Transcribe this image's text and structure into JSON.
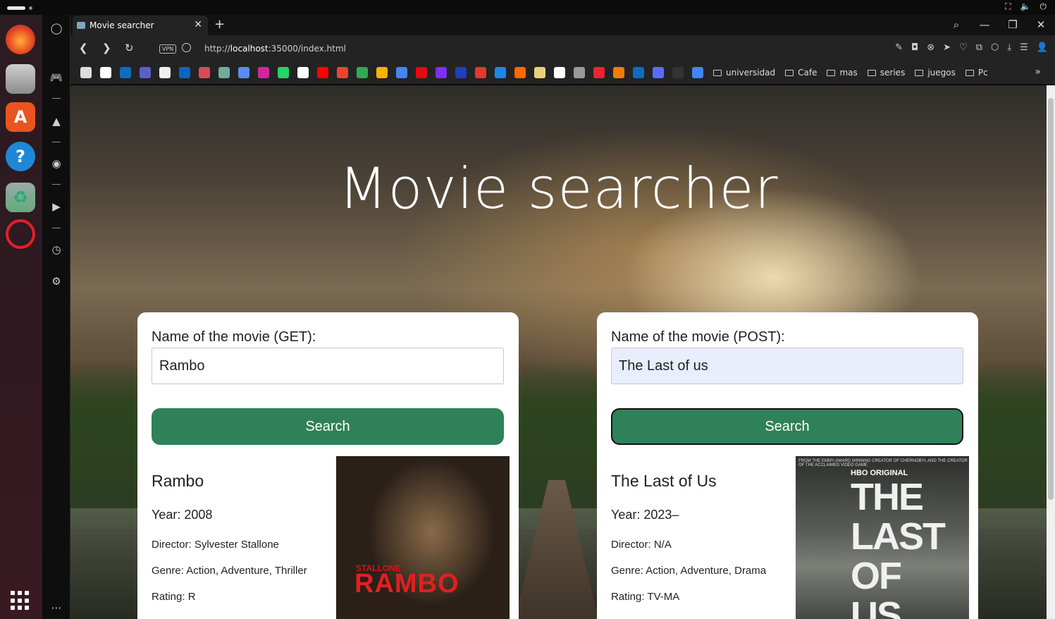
{
  "browser": {
    "tab_title": "Movie searcher",
    "url_prefix": "http://",
    "url_host": "localhost",
    "url_rest": ":35000/index.html",
    "vpn_label": "VPN",
    "bookmark_folders": [
      "universidad",
      "Cafe",
      "mas",
      "series",
      "juegos",
      "Pc"
    ]
  },
  "page": {
    "heading": "Movie searcher",
    "get_card": {
      "label": "Name of the movie (GET):",
      "input_value": "Rambo",
      "button": "Search",
      "movie": {
        "title": "Rambo",
        "year": "Year: 2008",
        "director": "Director: Sylvester Stallone",
        "genre": "Genre: Action, Adventure, Thriller",
        "rating": "Rating: R"
      },
      "poster": {
        "top": "STALLONE",
        "main": "RAMBO"
      }
    },
    "post_card": {
      "label": "Name of the movie (POST):",
      "input_value": "The Last of us",
      "button": "Search",
      "movie": {
        "title": "The Last of Us",
        "year": "Year: 2023–",
        "director": "Director: N/A",
        "genre": "Genre: Action, Adventure, Drama",
        "rating": "Rating: TV-MA"
      },
      "poster": {
        "tagline": "FROM THE EMMY-AWARD WINNING CREATOR OF CHERNOBYL AND THE CREATOR OF THE ACCLAIMED VIDEO GAME",
        "brand": "HBO ORIGINAL",
        "main": "THE LAST OF US"
      }
    }
  },
  "colors": {
    "accent_button": "#2f8159",
    "input_autofill": "#e8eefb",
    "card_bg": "#ffffff"
  }
}
